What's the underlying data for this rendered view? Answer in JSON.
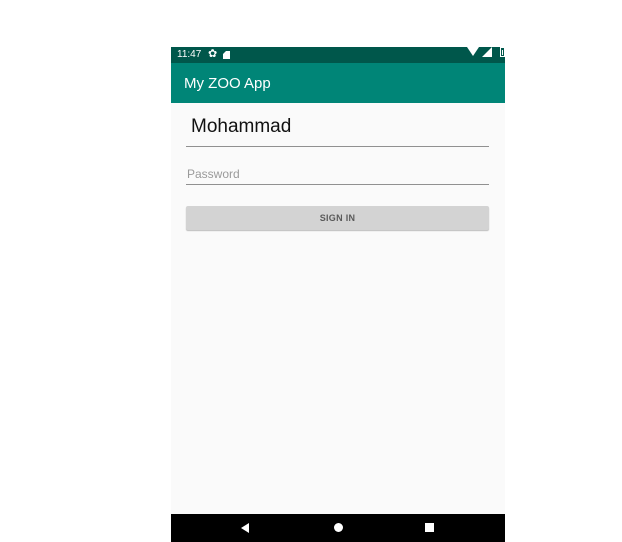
{
  "status_bar": {
    "time": "11:47",
    "icons": [
      "gear-icon",
      "sd-card-icon",
      "wifi-icon",
      "signal-icon",
      "battery-icon"
    ]
  },
  "app_bar": {
    "title": "My ZOO App",
    "color": "#008577"
  },
  "form": {
    "username_value": "Mohammad",
    "password_placeholder": "Password",
    "signin_label": "SIGN IN"
  },
  "nav_bar": {
    "icons": [
      "back-icon",
      "home-icon",
      "recents-icon"
    ]
  },
  "colors": {
    "status_bar": "#00574b",
    "app_bar": "#008577",
    "background": "#fafafa",
    "button": "#d3d3d3"
  }
}
